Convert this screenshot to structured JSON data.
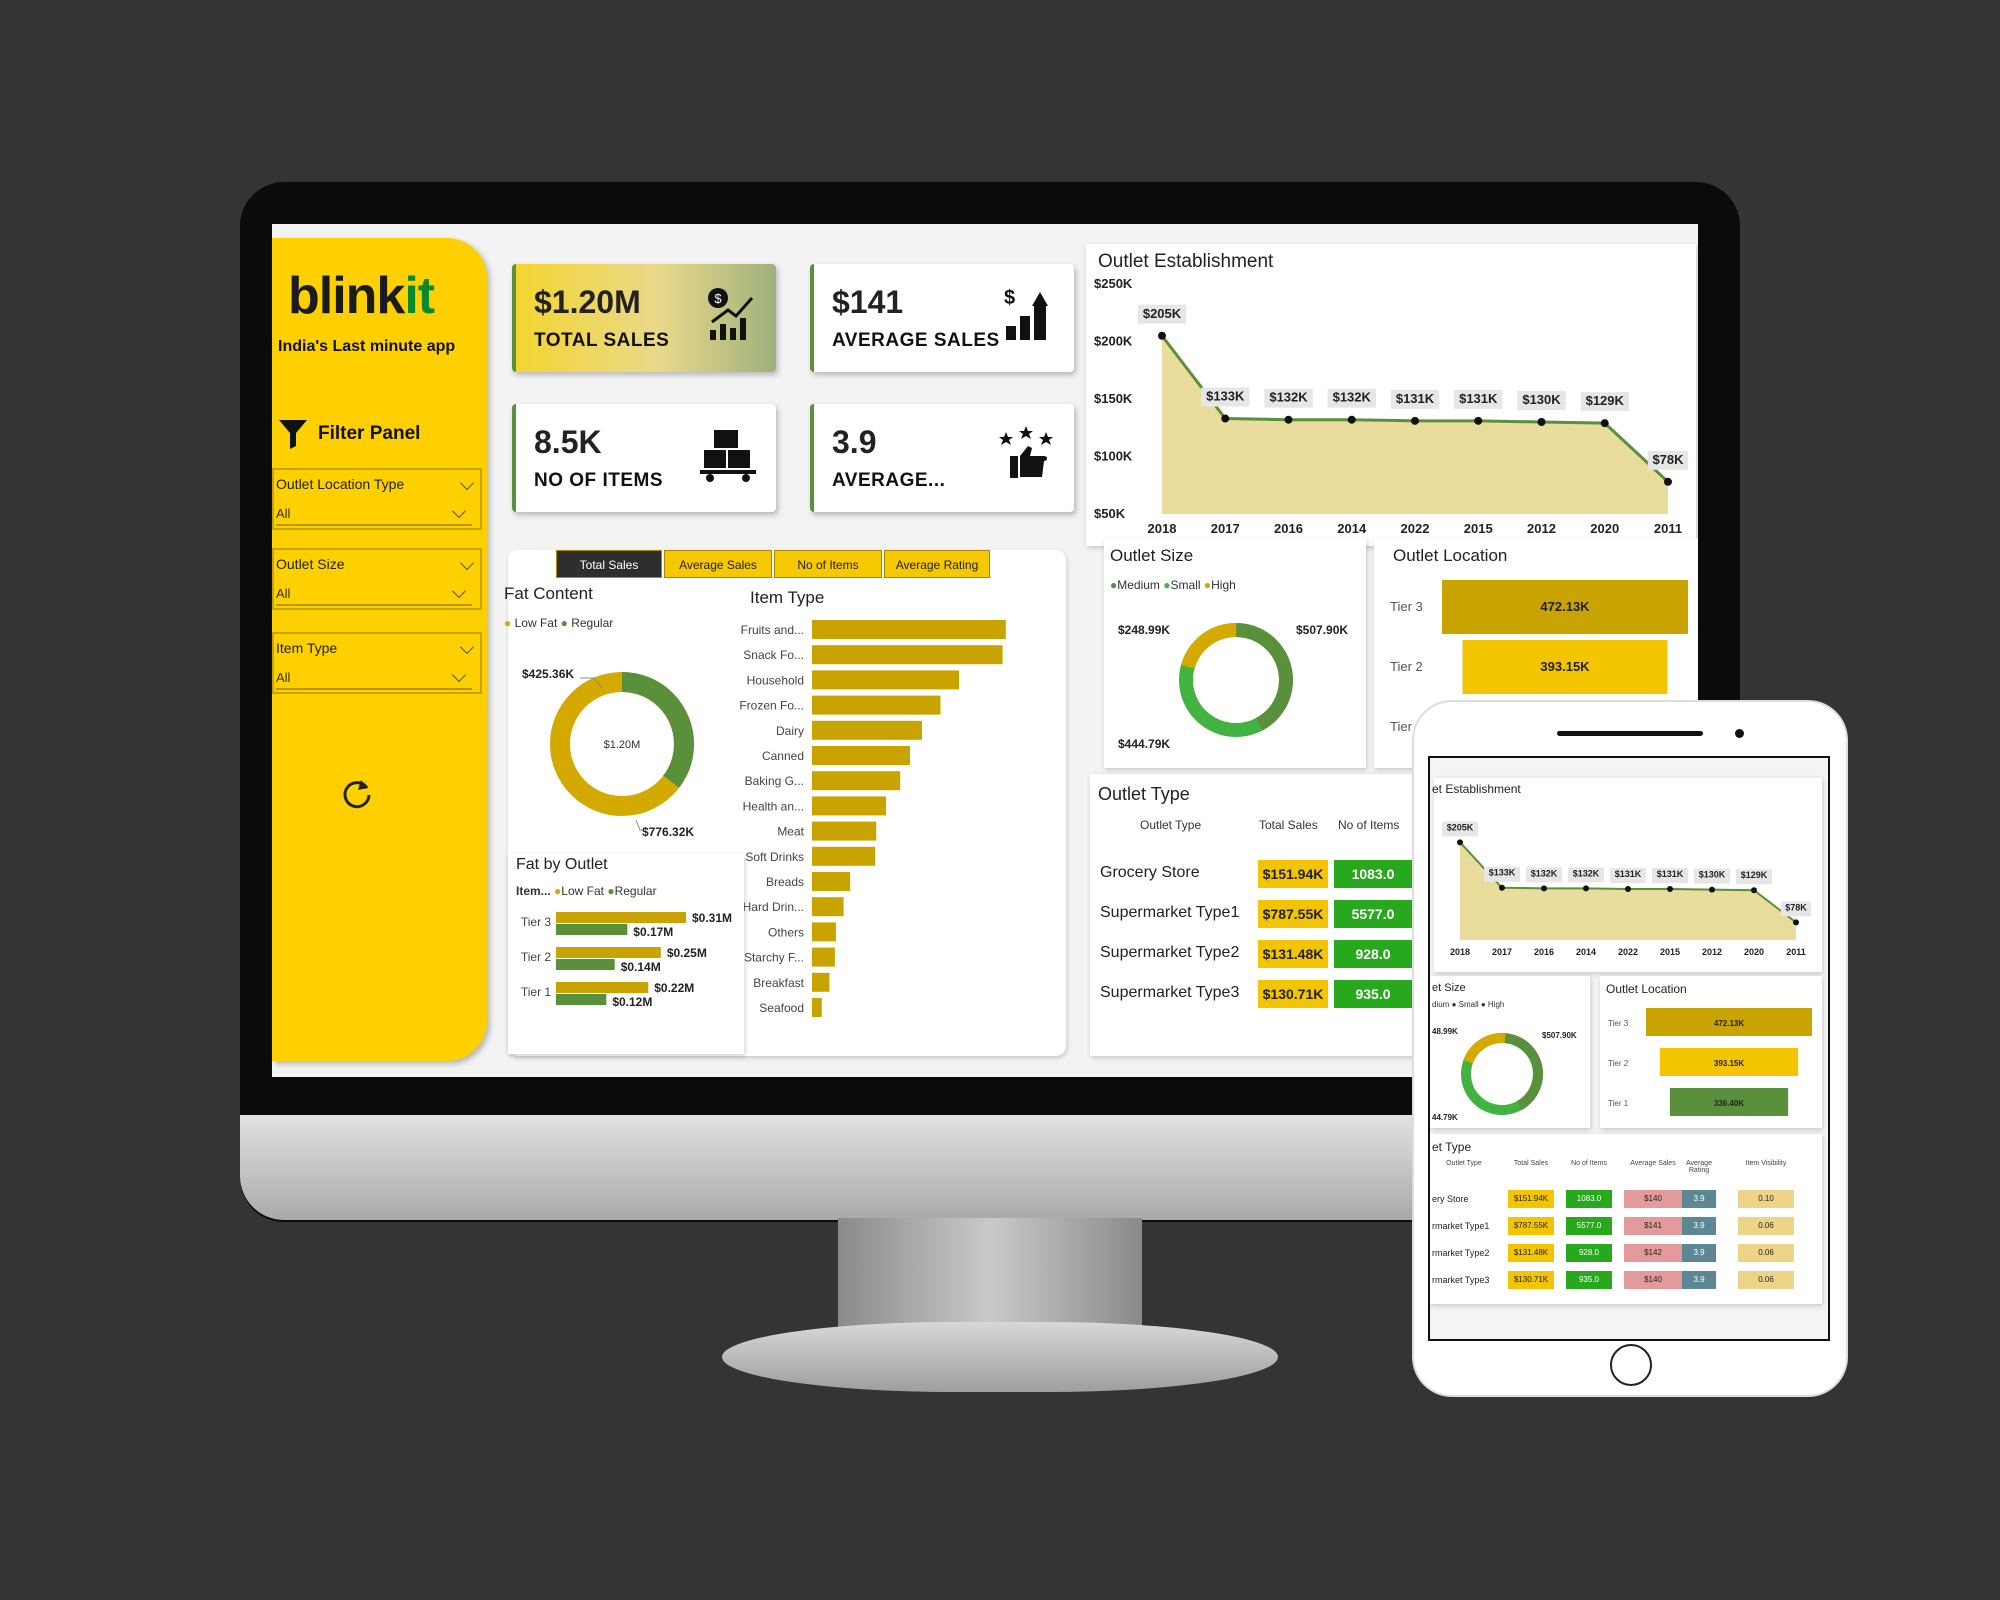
{
  "brand": {
    "name_main": "blink",
    "name_accent": "it",
    "tagline": "India's Last minute app"
  },
  "filter_panel": {
    "title": "Filter Panel",
    "slicers": [
      {
        "label": "Outlet Location Type",
        "value": "All"
      },
      {
        "label": "Outlet Size",
        "value": "All"
      },
      {
        "label": "Item Type",
        "value": "All"
      }
    ]
  },
  "kpis": [
    {
      "value": "$1.20M",
      "label": "TOTAL SALES",
      "icon": "money-growth-icon"
    },
    {
      "value": "$141",
      "label": "AVERAGE SALES",
      "icon": "dollar-bar-chart-icon"
    },
    {
      "value": "8.5K",
      "label": "NO OF ITEMS",
      "icon": "boxes-cart-icon"
    },
    {
      "value": "3.9",
      "label": "AVERAGE...",
      "icon": "thumbs-up-stars-icon"
    }
  ],
  "metric_buttons": [
    "Total Sales",
    "Average Sales",
    "No of Items",
    "Average Rating"
  ],
  "colors": {
    "yellow": "#F2C500",
    "dark_yellow": "#C9A300",
    "green": "#5A8F3C",
    "bright_green": "#27A81D",
    "low_fat": "#D4AA00",
    "regular": "#5A8F3C"
  },
  "chart_data": [
    {
      "type": "area",
      "title": "Outlet Establishment",
      "x": [
        "2018",
        "2017",
        "2016",
        "2014",
        "2022",
        "2015",
        "2012",
        "2020",
        "2011"
      ],
      "values": [
        205,
        133,
        132,
        132,
        131,
        131,
        130,
        129,
        78
      ],
      "data_labels": [
        "$205K",
        "$133K",
        "$132K",
        "$132K",
        "$131K",
        "$131K",
        "$130K",
        "$129K",
        "$78K"
      ],
      "y_ticks": [
        "$250K",
        "$200K",
        "$150K",
        "$100K",
        "$50K"
      ],
      "ylim": [
        50,
        250
      ]
    },
    {
      "type": "pie",
      "title": "Fat Content",
      "legend": [
        "Low Fat",
        "Regular"
      ],
      "values": [
        776.32,
        425.36
      ],
      "data_labels": [
        "$776.32K",
        "$425.36K"
      ],
      "center_label": "$1.20M"
    },
    {
      "type": "bar",
      "title": "Item Type",
      "categories": [
        "Fruits and...",
        "Snack Fo...",
        "Household",
        "Frozen Fo...",
        "Dairy",
        "Canned",
        "Baking G...",
        "Health an...",
        "Meat",
        "Soft Drinks",
        "Breads",
        "Hard Drin...",
        "Others",
        "Starchy F...",
        "Breakfast",
        "Seafood"
      ],
      "values": [
        178,
        175,
        135,
        118,
        101,
        90,
        81,
        68,
        59,
        58,
        35,
        29,
        22,
        21,
        16,
        9
      ]
    },
    {
      "type": "bar",
      "title": "Fat by Outlet",
      "legend_header": "Item...",
      "legend": [
        "Low Fat",
        "Regular"
      ],
      "categories": [
        "Tier 3",
        "Tier 2",
        "Tier 1"
      ],
      "series": [
        {
          "name": "Low Fat",
          "values": [
            0.31,
            0.25,
            0.22
          ],
          "labels": [
            "$0.31M",
            "$0.25M",
            "$0.22M"
          ]
        },
        {
          "name": "Regular",
          "values": [
            0.17,
            0.14,
            0.12
          ],
          "labels": [
            "$0.17M",
            "$0.14M",
            "$0.12M"
          ]
        }
      ]
    },
    {
      "type": "pie",
      "title": "Outlet Size",
      "legend": [
        "Medium",
        "Small",
        "High"
      ],
      "values": [
        507.9,
        444.79,
        248.99
      ],
      "data_labels": [
        "$507.90K",
        "$444.79K",
        "$248.99K"
      ]
    },
    {
      "type": "bar",
      "title": "Outlet Location",
      "categories": [
        "Tier 3",
        "Tier 2",
        "Tier 1"
      ],
      "values": [
        472.13,
        393.15,
        336.4
      ],
      "data_labels": [
        "472.13K",
        "393.15K",
        "336.40K"
      ]
    },
    {
      "type": "table",
      "title": "Outlet Type",
      "columns": [
        "Outlet Type",
        "Total Sales",
        "No of Items",
        "Average Sales",
        "Average Rating",
        "Item Visibility"
      ],
      "rows": [
        [
          "Grocery Store",
          "$151.94K",
          "1083.0",
          "$140",
          "3.9",
          "0.10"
        ],
        [
          "Supermarket Type1",
          "$787.55K",
          "5577.0",
          "$141",
          "3.9",
          "0.06"
        ],
        [
          "Supermarket Type2",
          "$131.48K",
          "928.0",
          "$142",
          "3.9",
          "0.06"
        ],
        [
          "Supermarket Type3",
          "$130.71K",
          "935.0",
          "$140",
          "3.9",
          "0.06"
        ]
      ]
    }
  ],
  "tablet": {
    "titles": {
      "est": "et Establishment",
      "size": "et Size",
      "loc": "Outlet Location",
      "type": "et Type"
    },
    "size_legend": "dium ● Small ● High",
    "size_labels": [
      "48.99K",
      "$507.90K",
      "44.79K"
    ],
    "row_names": [
      "ery Store",
      "rmarket Type1",
      "rmarket Type2",
      "rmarket Type3"
    ],
    "col_headers": [
      "Outlet Type",
      "Total Sales",
      "No of Items",
      "Average Sales",
      "Average Rating",
      "Item Visibility"
    ]
  }
}
